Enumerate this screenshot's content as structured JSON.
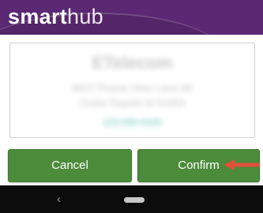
{
  "app": {
    "logo_bold": "smart",
    "logo_light": "hub"
  },
  "card": {
    "company": "ETelecom",
    "address_line1": "8807 Prairie View Lane 89",
    "address_line2": "Cedar Rapids IA 52404",
    "link": "123-555-0100"
  },
  "actions": {
    "cancel_label": "Cancel",
    "confirm_label": "Confirm"
  },
  "nav": {
    "back_glyph": "‹"
  },
  "colors": {
    "header": "#5b2873",
    "button": "#4c8b3a",
    "arrow": "#e0503a",
    "navbar": "#0c0c0c"
  }
}
